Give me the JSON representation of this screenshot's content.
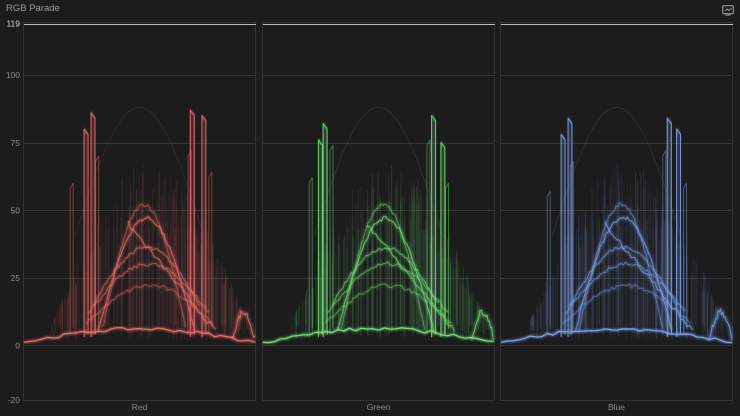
{
  "window": {
    "title": "RGB Parade",
    "settings_icon": "scope-settings-icon"
  },
  "scale": {
    "ticks": [
      "119",
      "100",
      "75",
      "50",
      "25",
      "0",
      "-20"
    ]
  },
  "panels": [
    {
      "label": "Red",
      "color": "#f06d6d"
    },
    {
      "label": "Green",
      "color": "#74e07a"
    },
    {
      "label": "Blue",
      "color": "#7fa2f0"
    }
  ]
}
